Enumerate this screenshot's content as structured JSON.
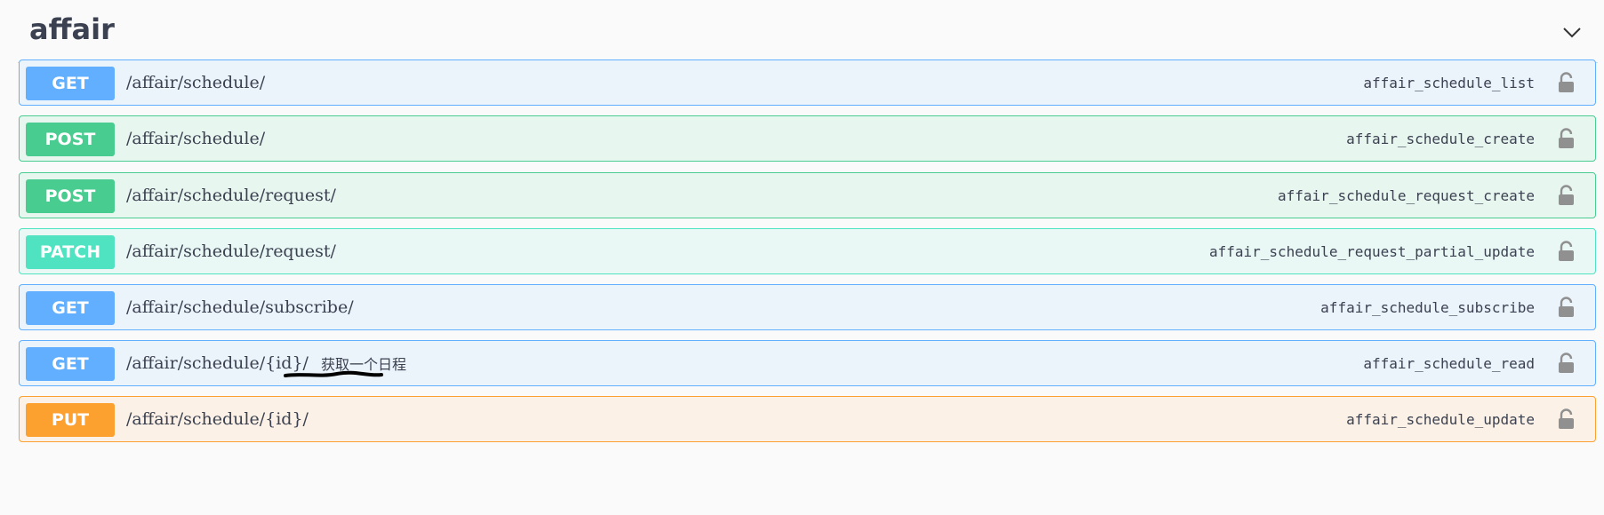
{
  "tag": {
    "title": "affair"
  },
  "operations": [
    {
      "method": "GET",
      "path": "/affair/schedule/",
      "summary": "",
      "operation_id": "affair_schedule_list"
    },
    {
      "method": "POST",
      "path": "/affair/schedule/",
      "summary": "",
      "operation_id": "affair_schedule_create"
    },
    {
      "method": "POST",
      "path": "/affair/schedule/request/",
      "summary": "",
      "operation_id": "affair_schedule_request_create"
    },
    {
      "method": "PATCH",
      "path": "/affair/schedule/request/",
      "summary": "",
      "operation_id": "affair_schedule_request_partial_update"
    },
    {
      "method": "GET",
      "path": "/affair/schedule/subscribe/",
      "summary": "",
      "operation_id": "affair_schedule_subscribe"
    },
    {
      "method": "GET",
      "path": "/affair/schedule/{id}/",
      "summary": "获取一个日程",
      "operation_id": "affair_schedule_read"
    },
    {
      "method": "PUT",
      "path": "/affair/schedule/{id}/",
      "summary": "",
      "operation_id": "affair_schedule_update"
    }
  ],
  "colors": {
    "get": "#61affe",
    "post": "#49cc90",
    "patch": "#50e3c2",
    "put": "#fca130",
    "text": "#3b4151",
    "lock": "#909090"
  },
  "icons": {
    "collapse": "chevron-down-icon",
    "auth": "unlocked-padlock-icon"
  }
}
